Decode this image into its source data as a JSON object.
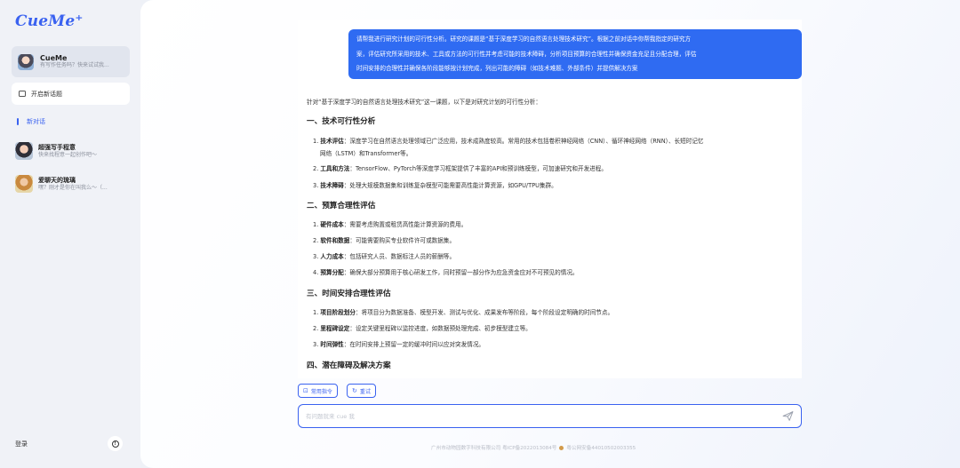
{
  "app": {
    "logo": "CueMe⁺"
  },
  "sidebar": {
    "bot": {
      "name": "CueMe",
      "subtitle": "有写作任务吗？快来试试我..."
    },
    "new_chat_label": "开启新话题",
    "active_conversation": "新对话",
    "history": [
      {
        "title": "超强写手程意",
        "subtitle": "快来找程意一起创作吧～"
      },
      {
        "title": "爱聊天的琉璃",
        "subtitle": "嘿？刚才是你在叫我么～（..."
      }
    ],
    "login_label": "登录",
    "info_icon": "info-icon"
  },
  "chat": {
    "user_message_lines": [
      "请帮我进行研究计划的可行性分析。研究的课题是“基于深度学习的自然语言处理技术研究”。根据之前对话中你帮我指定的研究方",
      "案，评估研究所采用的技术、工具或方法的可行性并考虑可能的技术障碍，分析项目预算的合理性并确保资金充足且分配合理，评估",
      "时间安排的合理性并确保各阶段能够按计划完成，列出可能的障碍（如技术难题、外部条件）并提供解决方案"
    ],
    "reply": {
      "intro": "针对“基于深度学习的自然语言处理技术研究”这一课题，以下是对研究计划的可行性分析：",
      "sections": [
        {
          "heading": "一、技术可行性分析",
          "items": [
            {
              "label": "技术评估",
              "text": "：深度学习在自然语言处理领域已广泛应用，技术成熟度较高。常用的技术包括卷积神经网络（CNN）、循环神经网络（RNN）、长短时记忆",
              "text2": "网络（LSTM）和Transformer等。"
            },
            {
              "label": "工具和方法",
              "text": "：TensorFlow、PyTorch等深度学习框架提供了丰富的API和预训练模型，可加速研究和开发进程。"
            },
            {
              "label": "技术障碍",
              "text": "：处理大规模数据集和训练复杂模型可能需要高性能计算资源，如GPU/TPU集群。"
            }
          ]
        },
        {
          "heading": "二、预算合理性评估",
          "items": [
            {
              "label": "硬件成本",
              "text": "：需要考虑购置或租赁高性能计算资源的费用。"
            },
            {
              "label": "软件和数据",
              "text": "：可能需要购买专业软件许可或数据集。"
            },
            {
              "label": "人力成本",
              "text": "：包括研究人员、数据标注人员的薪酬等。"
            },
            {
              "label": "预算分配",
              "text": "：确保大部分预算用于核心研发工作，同时预留一部分作为应急资金应对不可预见的情况。"
            }
          ]
        },
        {
          "heading": "三、时间安排合理性评估",
          "items": [
            {
              "label": "项目阶段划分",
              "text": "：将项目分为数据准备、模型开发、测试与优化、成果发布等阶段，每个阶段设定明确的时间节点。"
            },
            {
              "label": "里程碑设定",
              "text": "：设定关键里程碑以监控进度，如数据预处理完成、初步模型建立等。"
            },
            {
              "label": "时间弹性",
              "text": "：在时间安排上预留一定的缓冲时间以应对突发情况。"
            }
          ]
        },
        {
          "heading": "四、潜在障碍及解决方案",
          "items": []
        }
      ]
    },
    "actions": {
      "common_commands": "常用指令",
      "retry": "重试"
    },
    "input": {
      "placeholder": "有问题就来 cue 我"
    }
  },
  "footer": {
    "icp": "广州市动物园数字科技有限公司 粤ICP备2022013084号",
    "police": "粤公网安备44010502003355"
  }
}
